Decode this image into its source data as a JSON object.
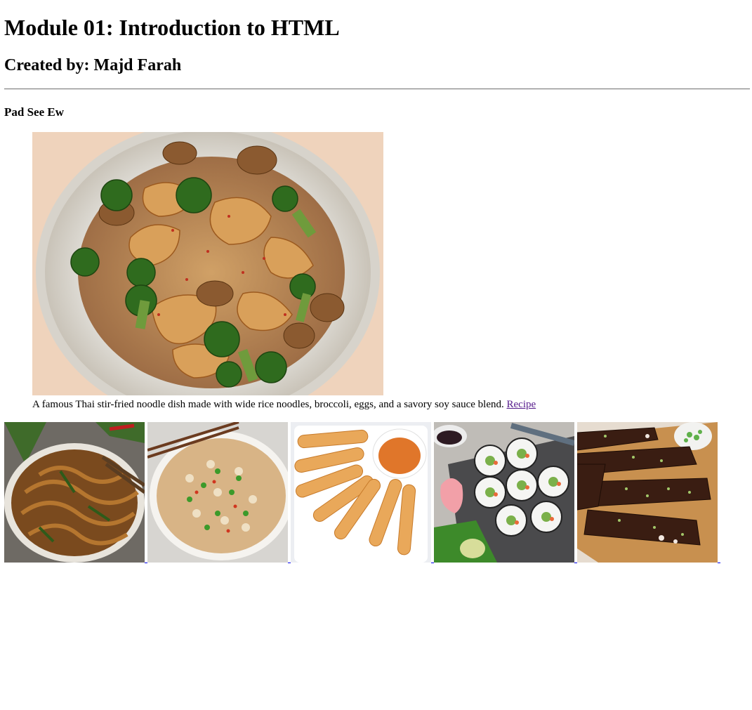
{
  "page": {
    "heading": "Module 01: Introduction to HTML",
    "author": "Created by: Majd Farah"
  },
  "featured": {
    "title": "Pad See Ew",
    "image_alt": "Pad See Ew",
    "description": "A famous Thai stir-fried noodle dish made with wide rice noodles, broccoli, eggs, and a savory soy sauce blend.",
    "link_text": "Recipe"
  },
  "colors": {
    "visited_link": "#551a8b",
    "link": "#0000ee",
    "rule": "#7a7a7a"
  }
}
